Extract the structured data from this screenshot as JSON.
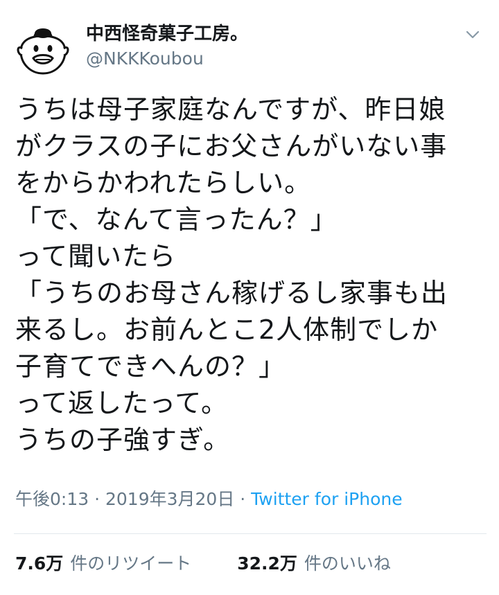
{
  "user": {
    "display_name": "中西怪奇菓子工房。",
    "handle": "@NKKKoubou"
  },
  "tweet": {
    "lines": [
      "うちは母子家庭なんですが、昨日娘",
      "がクラスの子にお父さんがいない事",
      "をからかわれたらしい。",
      "「で、なんて言ったん？」",
      "って聞いたら",
      "「うちのお母さん稼げるし家事も出",
      "来るし。お前んとこ2人体制でしか",
      "子育てできへんの？」",
      "って返したって。",
      "うちの子強すぎ。"
    ]
  },
  "meta": {
    "time": "午後0:13",
    "separator": " · ",
    "date": "2019年3月20日",
    "source": "Twitter for iPhone"
  },
  "stats": {
    "retweets_count": "7.6万",
    "retweets_label": "件のリツイート",
    "likes_count": "32.2万",
    "likes_label": "件のいいね"
  },
  "colors": {
    "link": "#1da1f2",
    "secondary_text": "#657786",
    "primary_text": "#14171a",
    "divider": "#e1e8ed"
  },
  "icons": {
    "avatar": "cartoon-face-avatar",
    "caret": "chevron-down-icon"
  }
}
